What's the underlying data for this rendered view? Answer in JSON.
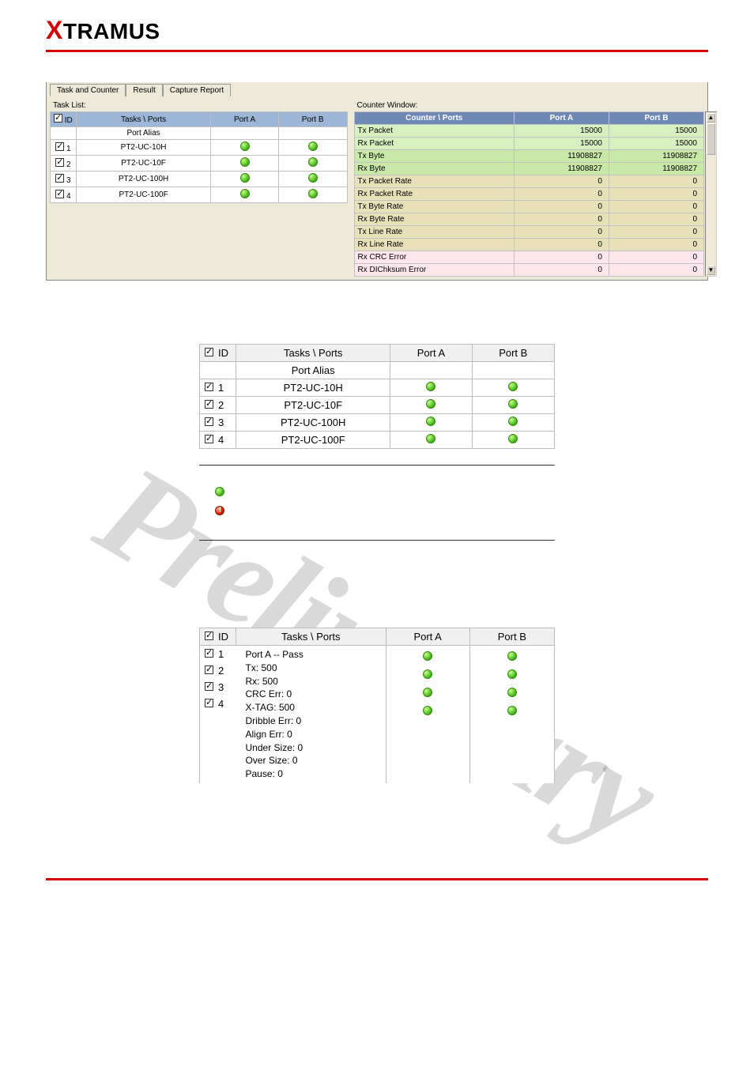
{
  "brand": {
    "name_prefix": "X",
    "name_rest": "TRAMUS"
  },
  "watermark": "Preliminary",
  "app": {
    "tabs": [
      "Task and Counter",
      "Result",
      "Capture Report"
    ],
    "task_list_label": "Task List:",
    "counter_window_label": "Counter Window:",
    "task_header": {
      "id_hdr": "ID",
      "tasks_hdr": "Tasks \\ Ports",
      "porta": "Port A",
      "portb": "Port B",
      "alias_hdr": "Port Alias"
    },
    "task_rows": [
      {
        "id": "1",
        "name": "PT2-UC-10H"
      },
      {
        "id": "2",
        "name": "PT2-UC-10F"
      },
      {
        "id": "3",
        "name": "PT2-UC-100H"
      },
      {
        "id": "4",
        "name": "PT2-UC-100F"
      }
    ],
    "counter_header": {
      "cp": "Counter \\ Ports",
      "porta": "Port A",
      "portb": "Port B"
    },
    "counter_rows": [
      {
        "name": "Tx Packet",
        "a": "15000",
        "b": "15000",
        "cls": "row-green"
      },
      {
        "name": "Rx Packet",
        "a": "15000",
        "b": "15000",
        "cls": "row-green"
      },
      {
        "name": "Tx Byte",
        "a": "11908827",
        "b": "11908827",
        "cls": "row-green2"
      },
      {
        "name": "Rx Byte",
        "a": "11908827",
        "b": "11908827",
        "cls": "row-green2"
      },
      {
        "name": "Tx Packet Rate",
        "a": "0",
        "b": "0",
        "cls": "row-tan"
      },
      {
        "name": "Rx Packet Rate",
        "a": "0",
        "b": "0",
        "cls": "row-tan"
      },
      {
        "name": "Tx Byte Rate",
        "a": "0",
        "b": "0",
        "cls": "row-tan"
      },
      {
        "name": "Rx Byte Rate",
        "a": "0",
        "b": "0",
        "cls": "row-tan"
      },
      {
        "name": "Tx Line Rate",
        "a": "0",
        "b": "0",
        "cls": "row-tan"
      },
      {
        "name": "Rx Line Rate",
        "a": "0",
        "b": "0",
        "cls": "row-tan"
      },
      {
        "name": "Rx CRC Error",
        "a": "0",
        "b": "0",
        "cls": "row-pink"
      },
      {
        "name": "Rx DIChksum Error",
        "a": "0",
        "b": "0",
        "cls": "row-pink"
      }
    ]
  },
  "mid": {
    "header": {
      "id_hdr": "ID",
      "tasks_hdr": "Tasks \\ Ports",
      "porta": "Port A",
      "portb": "Port B",
      "alias_hdr": "Port Alias"
    },
    "rows": [
      {
        "id": "1",
        "name": "PT2-UC-10H"
      },
      {
        "id": "2",
        "name": "PT2-UC-10F"
      },
      {
        "id": "3",
        "name": "PT2-UC-100H"
      },
      {
        "id": "4",
        "name": "PT2-UC-100F"
      }
    ]
  },
  "bot": {
    "header": {
      "id_hdr": "ID",
      "tasks_hdr": "Tasks \\ Ports",
      "porta": "Port A",
      "portb": "Port B"
    },
    "rows": [
      {
        "id": "1"
      },
      {
        "id": "2"
      },
      {
        "id": "3"
      },
      {
        "id": "4"
      }
    ],
    "tooltip": {
      "l1": "Port A  -- Pass",
      "l2": "Tx: 500",
      "l3": "Rx: 500",
      "l4": "CRC Err: 0",
      "l5": "X-TAG: 500",
      "l6": "Dribble Err: 0",
      "l7": "Align Err: 0",
      "l8": "Under Size: 0",
      "l9": "Over Size: 0",
      "l10": "Pause: 0"
    }
  }
}
